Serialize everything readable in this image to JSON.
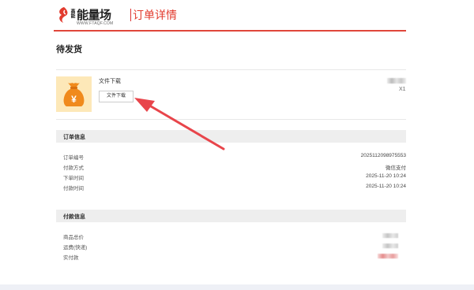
{
  "header": {
    "logo_small": "高能",
    "logo_name": "能量场",
    "logo_url": "WWW.FTAQF.COM",
    "page_title": "订单详情"
  },
  "order_status": "待发货",
  "product": {
    "name": "文件下载",
    "download_button": "文件下载",
    "quantity": "X1",
    "thumbnail_icon": "money-bag-yen-icon"
  },
  "order_info": {
    "title": "订单信息",
    "rows": [
      {
        "label": "订单编号",
        "value": "2025112098975553"
      },
      {
        "label": "付款方式",
        "value": "微信支付"
      },
      {
        "label": "下单时间",
        "value": "2025-11-20 10:24"
      },
      {
        "label": "付款时间",
        "value": "2025-11-20 10:24"
      }
    ]
  },
  "payment_info": {
    "title": "付款信息",
    "rows": [
      {
        "label": "商品总价"
      },
      {
        "label": "运费(快递)"
      },
      {
        "label": "实付款"
      }
    ]
  },
  "colors": {
    "brand_red": "#e23b2e",
    "thumb_bg": "#fde8b8",
    "bag_orange": "#f08a1c",
    "section_bg": "#eeeeee"
  }
}
